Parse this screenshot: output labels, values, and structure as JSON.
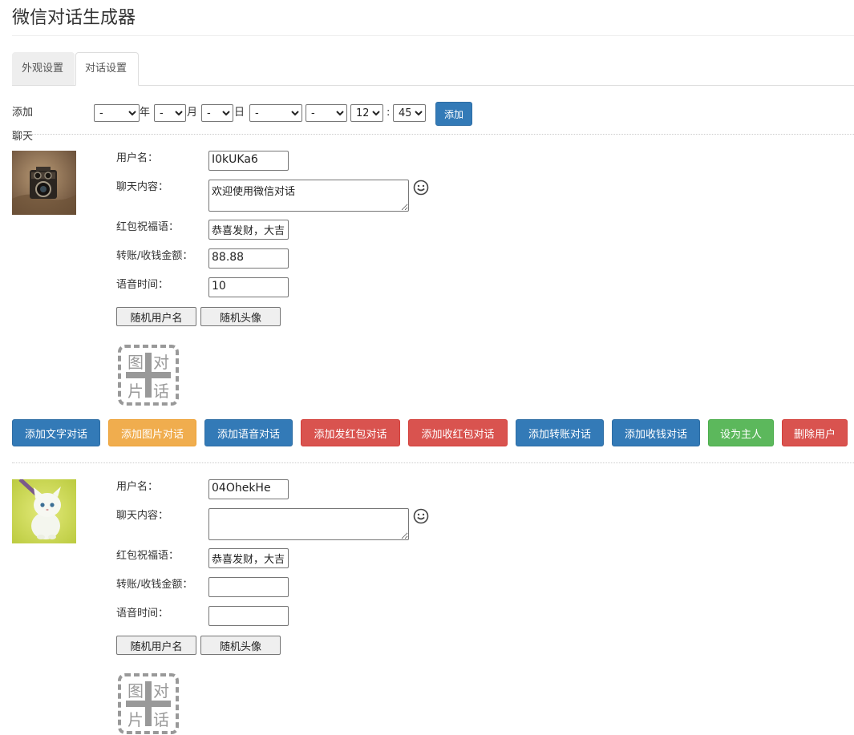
{
  "app": {
    "title": "微信对话生成器"
  },
  "tabs": [
    {
      "label": "外观设置",
      "active": false
    },
    {
      "label": "对话设置",
      "active": true
    }
  ],
  "time_row": {
    "label": "添加聊天时间：",
    "year_value": "-",
    "year_unit": "年",
    "month_value": "-",
    "month_unit": "月",
    "day_value": "-",
    "day_unit": "日",
    "select4_value": "-",
    "select5_value": "-",
    "hour_value": "12",
    "colon": ":",
    "minute_value": "45",
    "add_button": "添加"
  },
  "labels": {
    "username": "用户名：",
    "chat_content": "聊天内容：",
    "redpacket_blessing": "红包祝福语：",
    "transfer_amount": "转账/收钱金额：",
    "voice_duration": "语音时间："
  },
  "buttons": {
    "random_username": "随机用户名",
    "random_avatar": "随机头像",
    "add_text": "添加文字对话",
    "add_image": "添加图片对话",
    "add_voice": "添加语音对话",
    "add_send_redpacket": "添加发红包对话",
    "add_receive_redpacket": "添加收红包对话",
    "add_transfer": "添加转账对话",
    "add_receive_money": "添加收钱对话",
    "set_host": "设为主人",
    "delete_user": "删除用户"
  },
  "image_placeholder": {
    "chars": [
      "图",
      "对",
      "片",
      "话"
    ]
  },
  "users": [
    {
      "avatar_icon": "camera-photo",
      "username": "I0kUKa6",
      "chat_content": "欢迎使用微信对话",
      "redpacket_blessing": "恭喜发财，大吉",
      "transfer_amount": "88.88",
      "voice_duration": "10"
    },
    {
      "avatar_icon": "white-kitten-photo",
      "username": "04OhekHe",
      "chat_content": "",
      "redpacket_blessing": "恭喜发财，大吉",
      "transfer_amount": "",
      "voice_duration": ""
    }
  ],
  "colors": {
    "primary": "#337ab7",
    "warning": "#f0ad4e",
    "danger": "#d9534f",
    "success": "#5cb85c"
  }
}
